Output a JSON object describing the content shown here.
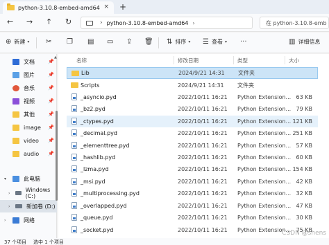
{
  "tab": {
    "title": "python-3.10.8-embed-amd64",
    "close": "×",
    "new": "+"
  },
  "nav": {
    "back": "←",
    "forward": "→",
    "up": "↑",
    "refresh": "↻",
    "more": "›"
  },
  "address": {
    "separator": "›",
    "crumb": "python-3.10.8-embed-amd64"
  },
  "search": {
    "placeholder": "在 python-3.10.8-emb"
  },
  "toolbar": {
    "new_label": "新建",
    "sort_label": "排序",
    "view_label": "查看",
    "details_label": "详细信息"
  },
  "sidebar": {
    "items": [
      {
        "label": "文档",
        "icon": "document-icon",
        "pinned": true
      },
      {
        "label": "图片",
        "icon": "picture-icon",
        "pinned": true
      },
      {
        "label": "音乐",
        "icon": "music-icon",
        "pinned": true
      },
      {
        "label": "视频",
        "icon": "video-icon",
        "pinned": true
      },
      {
        "label": "其他",
        "icon": "folder-icon",
        "pinned": true
      },
      {
        "label": "image",
        "icon": "folder-icon",
        "pinned": true
      },
      {
        "label": "video",
        "icon": "folder-icon",
        "pinned": true
      },
      {
        "label": "audio",
        "icon": "folder-icon",
        "pinned": true
      },
      {
        "label": "此电脑",
        "icon": "computer-icon",
        "pinned": false
      },
      {
        "label": "Windows (C:)",
        "icon": "drive-icon",
        "pinned": false
      },
      {
        "label": "新加卷 (D:)",
        "icon": "drive-icon",
        "pinned": false
      },
      {
        "label": "网络",
        "icon": "network-icon",
        "pinned": false
      }
    ]
  },
  "columns": {
    "name": "名称",
    "date": "修改日期",
    "type": "类型",
    "size": "大小"
  },
  "files": [
    {
      "name": "Lib",
      "date": "2024/9/21 14:31",
      "type": "文件夹",
      "size": "",
      "kind": "folder"
    },
    {
      "name": "Scripts",
      "date": "2024/9/21 14:31",
      "type": "文件夹",
      "size": "",
      "kind": "folder"
    },
    {
      "name": "_asyncio.pyd",
      "date": "2022/10/11 16:21",
      "type": "Python Extension...",
      "size": "63 KB",
      "kind": "file"
    },
    {
      "name": "_bz2.pyd",
      "date": "2022/10/11 16:21",
      "type": "Python Extension...",
      "size": "79 KB",
      "kind": "file"
    },
    {
      "name": "_ctypes.pyd",
      "date": "2022/10/11 16:21",
      "type": "Python Extension...",
      "size": "121 KB",
      "kind": "file"
    },
    {
      "name": "_decimal.pyd",
      "date": "2022/10/11 16:21",
      "type": "Python Extension...",
      "size": "251 KB",
      "kind": "file"
    },
    {
      "name": "_elementtree.pyd",
      "date": "2022/10/11 16:21",
      "type": "Python Extension...",
      "size": "57 KB",
      "kind": "file"
    },
    {
      "name": "_hashlib.pyd",
      "date": "2022/10/11 16:21",
      "type": "Python Extension...",
      "size": "60 KB",
      "kind": "file"
    },
    {
      "name": "_lzma.pyd",
      "date": "2022/10/11 16:21",
      "type": "Python Extension...",
      "size": "154 KB",
      "kind": "file"
    },
    {
      "name": "_msi.pyd",
      "date": "2022/10/11 16:21",
      "type": "Python Extension...",
      "size": "42 KB",
      "kind": "file"
    },
    {
      "name": "_multiprocessing.pyd",
      "date": "2022/10/11 16:21",
      "type": "Python Extension...",
      "size": "32 KB",
      "kind": "file"
    },
    {
      "name": "_overlapped.pyd",
      "date": "2022/10/11 16:21",
      "type": "Python Extension...",
      "size": "47 KB",
      "kind": "file"
    },
    {
      "name": "_queue.pyd",
      "date": "2022/10/11 16:21",
      "type": "Python Extension...",
      "size": "30 KB",
      "kind": "file"
    },
    {
      "name": "_socket.pyd",
      "date": "2022/10/11 16:21",
      "type": "Python Extension...",
      "size": "75 KB",
      "kind": "file"
    }
  ],
  "status": {
    "count": "37 个项目",
    "selected": "选中 1 个项目"
  },
  "watermark": "CSDN @shens"
}
